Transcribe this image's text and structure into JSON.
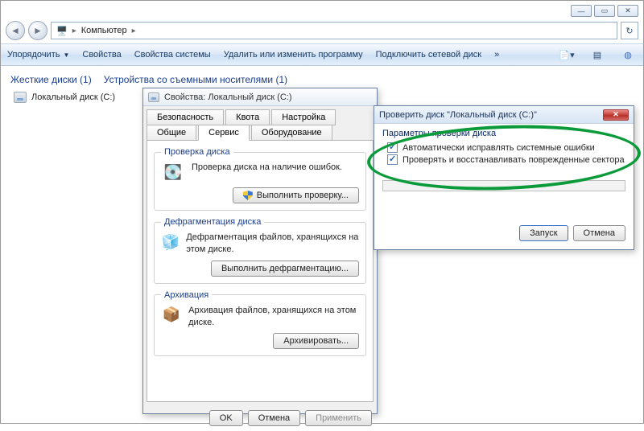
{
  "window": {
    "breadcrumb_root": "Компьютер",
    "min_symbol": "—",
    "max_symbol": "▭",
    "close_symbol": "✕",
    "refresh_symbol": "↻"
  },
  "toolbar": {
    "organize": "Упорядочить",
    "properties": "Свойства",
    "system_props": "Свойства системы",
    "uninstall": "Удалить или изменить программу",
    "map_drive": "Подключить сетевой диск",
    "more": "»"
  },
  "content": {
    "group_hdd": "Жесткие диски (1)",
    "group_removable": "Устройства со съемными носителями (1)",
    "drive_label": "Локальный диск (C:)"
  },
  "props_dialog": {
    "title": "Свойства: Локальный диск (C:)",
    "tabs_row1": [
      "Безопасность",
      "Квота",
      "Настройка"
    ],
    "tabs_row2": [
      "Общие",
      "Сервис",
      "Оборудование"
    ],
    "active_tab": 1,
    "group_check": {
      "legend": "Проверка диска",
      "text": "Проверка диска на наличие ошибок.",
      "button": "Выполнить проверку..."
    },
    "group_defrag": {
      "legend": "Дефрагментация диска",
      "text": "Дефрагментация файлов, хранящихся на этом диске.",
      "button": "Выполнить дефрагментацию..."
    },
    "group_backup": {
      "legend": "Архивация",
      "text": "Архивация файлов, хранящихся на этом диске.",
      "button": "Архивировать..."
    },
    "ok": "OK",
    "cancel": "Отмена",
    "apply": "Применить"
  },
  "check_dialog": {
    "title": "Проверить диск \"Локальный диск (C:)\"",
    "params_label": "Параметры проверки диска",
    "opt_fix_errors": "Автоматически исправлять системные ошибки",
    "opt_scan_sectors": "Проверять и восстанавливать поврежденные сектора",
    "start": "Запуск",
    "cancel": "Отмена"
  }
}
